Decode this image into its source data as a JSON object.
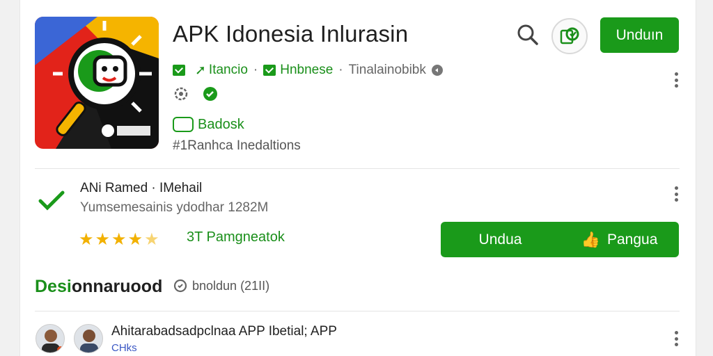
{
  "app": {
    "title": "APK Idonesia Inlurasin",
    "install_label": "Unduın",
    "meta": {
      "tag1": "Itancio",
      "tag2": "Hnbnese",
      "developer": "Tinalainobibk"
    },
    "badge_label": "Badosk",
    "tagline": "#1Ranhca Inedaltions"
  },
  "version_section": {
    "title": "ANi Ramed · IMehail",
    "subtitle": "Yumsemesainis ydodhar 1282M",
    "rating_label": "3T Pamgneatok",
    "rating_stars": 4.5,
    "download_label": "Undua",
    "share_label": "Pangua"
  },
  "discussion": {
    "heading_green": "Desi",
    "heading_dark": "onnaruood",
    "meta": "bnoldun (21II)"
  },
  "news": {
    "title": "Ahitarabadsadpclnaa APP Ibetial; APP",
    "subtitle": "CHks"
  },
  "colors": {
    "accent": "#1a9a1a",
    "star": "#f2b100"
  }
}
